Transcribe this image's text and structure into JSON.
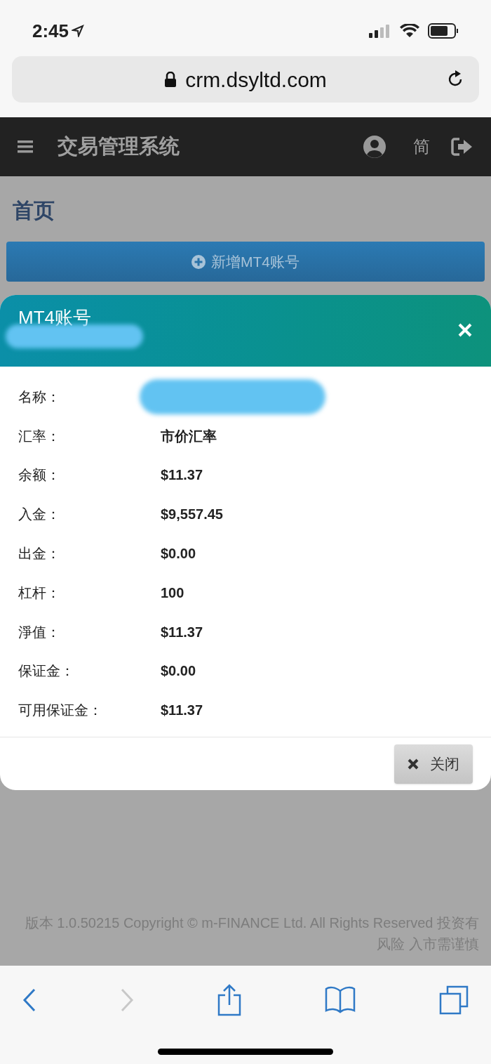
{
  "status_bar": {
    "time": "2:45"
  },
  "address_bar": {
    "url": "crm.dsyltd.com"
  },
  "navbar": {
    "title": "交易管理系统",
    "language": "简"
  },
  "page": {
    "heading": "首页",
    "add_button": "新增MT4账号"
  },
  "modal": {
    "title": "MT4账号",
    "rows": [
      {
        "label": "名称：",
        "value": "",
        "redacted": true
      },
      {
        "label": "汇率：",
        "value": "市价汇率",
        "redacted": false
      },
      {
        "label": "余额：",
        "value": "$11.37",
        "redacted": false
      },
      {
        "label": "入金：",
        "value": "$9,557.45",
        "redacted": false
      },
      {
        "label": "出金：",
        "value": "$0.00",
        "redacted": false
      },
      {
        "label": "杠杆：",
        "value": "100",
        "redacted": false
      },
      {
        "label": "淨值：",
        "value": "$11.37",
        "redacted": false
      },
      {
        "label": "保证金：",
        "value": "$0.00",
        "redacted": false
      },
      {
        "label": "可用保证金：",
        "value": "$11.37",
        "redacted": false
      }
    ],
    "close_button": "关闭"
  },
  "footer": {
    "text": "版本 1.0.50215   Copyright © m-FINANCE Ltd. All Rights Reserved 投资有风险 入市需谨慎"
  },
  "toolbar": [
    {
      "kind": "back",
      "disabled": false
    },
    {
      "kind": "forward",
      "disabled": true
    },
    {
      "kind": "share",
      "disabled": false
    },
    {
      "kind": "bookmarks",
      "disabled": false
    },
    {
      "kind": "tabs",
      "disabled": false
    }
  ]
}
